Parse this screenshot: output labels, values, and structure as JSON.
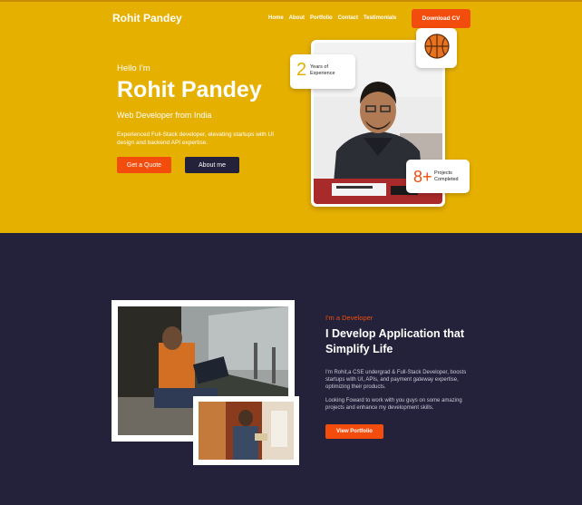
{
  "brand": "Rohit Pandey",
  "nav": [
    "Home",
    "About",
    "Portfolio",
    "Contact",
    "Testimonials"
  ],
  "download_cv": "Download CV",
  "hero": {
    "greeting": "Hello I'm",
    "name": "Rohit Pandey",
    "role": "Web Developer from India",
    "description": "Experienced Full-Stack developer, elevating startups with UI design and backend API expertise.",
    "quote_button": "Get a Quote",
    "about_button": "About me",
    "experience_number": "2",
    "experience_label": "Years of Experience",
    "projects_number": "8+",
    "projects_label": "Projects Completed"
  },
  "about": {
    "eyebrow": "I'm a Developer",
    "heading": "I Develop Application that Simplify Life",
    "paragraph1": "I'm Rohit,a CSE undergrad & Full-Stack Developer, boosts startups with UI, APIs, and payment gateway expertise, optimizing their products.",
    "paragraph2": "Looking Foward to work with you guys on some amazing projects and enhance my development skills.",
    "portfolio_button": "View Portfolio"
  },
  "colors": {
    "hero_bg": "#e6b000",
    "accent": "#f24d0c",
    "dark": "#23223a"
  },
  "icons": {
    "basketball": "basketball-icon"
  }
}
